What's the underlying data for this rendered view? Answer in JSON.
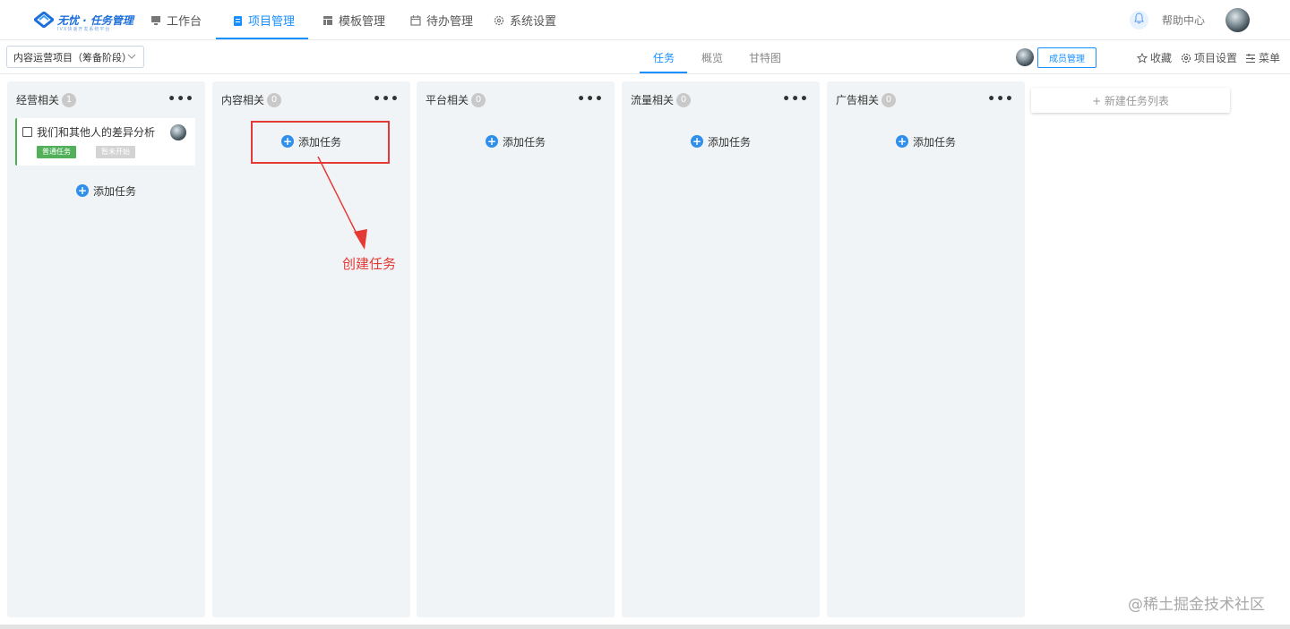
{
  "brand": {
    "name": "无忧 · 任务管理",
    "subtitle": "IVX快速开发系统平台"
  },
  "nav": {
    "items": [
      {
        "label": "工作台",
        "icon": "monitor-icon"
      },
      {
        "label": "项目管理",
        "icon": "clipboard-icon",
        "active": true
      },
      {
        "label": "模板管理",
        "icon": "template-icon"
      },
      {
        "label": "待办管理",
        "icon": "calendar-icon"
      },
      {
        "label": "系统设置",
        "icon": "gear-icon"
      }
    ],
    "help": "帮助中心"
  },
  "toolbar": {
    "project_select": "内容运营项目（筹备阶段）",
    "tabs": [
      {
        "label": "任务",
        "active": true
      },
      {
        "label": "概览"
      },
      {
        "label": "甘特图"
      }
    ],
    "member_button": "成员管理",
    "favorite": "收藏",
    "project_settings": "项目设置",
    "menu": "菜单"
  },
  "board": {
    "add_task_label": "添加任务",
    "new_list_label": "+ 新建任务列表",
    "columns": [
      {
        "title": "经营相关",
        "count": "1",
        "tasks": [
          {
            "title": "我们和其他人的差异分析",
            "type": "普通任务",
            "status": "暂未开始"
          }
        ]
      },
      {
        "title": "内容相关",
        "count": "0"
      },
      {
        "title": "平台相关",
        "count": "0"
      },
      {
        "title": "流量相关",
        "count": "0"
      },
      {
        "title": "广告相关",
        "count": "0"
      }
    ]
  },
  "annotation": {
    "text": "创建任务",
    "color": "#e53935"
  },
  "watermark": "@稀土掘金技术社区",
  "colors": {
    "accent": "#1890ff",
    "column_bg": "#f1f4f6",
    "task_type": "#52b05a"
  }
}
